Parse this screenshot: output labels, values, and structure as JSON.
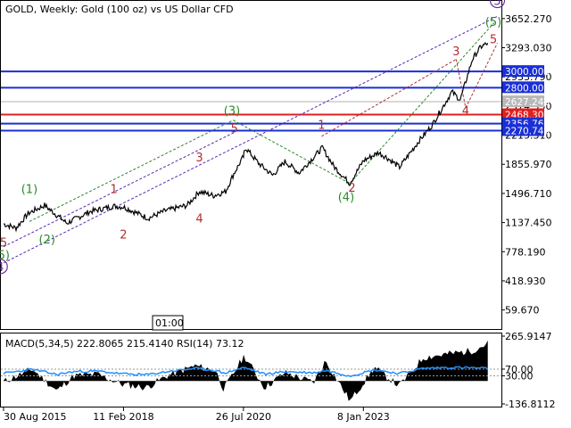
{
  "window": {
    "title": "GOLD, Weekly:  Gold (100 oz) vs US Dollar CFD",
    "time_badge": "01:00"
  },
  "chart_data": [
    {
      "type": "line",
      "title": "GOLD, Weekly:  Gold (100 oz) vs US Dollar CFD",
      "ylim": [
        -175,
        3870
      ],
      "price_ticks": [
        "3652.270",
        "3293.030",
        "2933.790",
        "2574.550",
        "2215.310",
        "1855.970",
        "1496.710",
        "1137.450",
        "778.190",
        "418.930",
        "59.670"
      ],
      "x_ticks": [
        "30 Aug 2015",
        "11 Feb 2018",
        "26 Jul 2020",
        "8 Jan 2023"
      ],
      "x_tick_dates": [
        "2015-08-30",
        "2018-02-11",
        "2020-07-26",
        "2023-01-08"
      ],
      "x_range": [
        "2015-08-30",
        "2025-10-15"
      ],
      "grid": false,
      "price_series": {
        "name": "GOLD",
        "x": [
          "2015-08-30",
          "2015-12-01",
          "2016-03-01",
          "2016-07-01",
          "2016-12-15",
          "2017-06-01",
          "2017-12-01",
          "2018-02-11",
          "2018-08-15",
          "2018-12-15",
          "2019-06-01",
          "2019-09-01",
          "2019-12-15",
          "2020-03-15",
          "2020-05-15",
          "2020-07-26",
          "2020-08-10",
          "2020-11-15",
          "2021-03-01",
          "2021-06-01",
          "2021-09-15",
          "2022-03-08",
          "2022-06-01",
          "2022-09-28",
          "2023-01-08",
          "2023-05-01",
          "2023-07-01",
          "2023-10-05",
          "2024-03-01",
          "2024-06-01",
          "2024-10-30",
          "2025-01-01",
          "2025-04-01",
          "2025-06-01",
          "2025-07-25"
        ],
        "y": [
          1120,
          1070,
          1250,
          1350,
          1130,
          1270,
          1340,
          1330,
          1190,
          1280,
          1350,
          1520,
          1470,
          1520,
          1740,
          1950,
          2060,
          1870,
          1720,
          1890,
          1750,
          2060,
          1830,
          1620,
          1900,
          2000,
          1940,
          1820,
          2150,
          2330,
          2750,
          2650,
          3150,
          3300,
          3350
        ]
      },
      "levels": [
        {
          "label": "3000.000",
          "value": 3000,
          "color": "#1a2fd6"
        },
        {
          "label": "2800.000",
          "value": 2800,
          "color": "#1a2fd6"
        },
        {
          "label": "2627.240",
          "value": 2627.24,
          "color": "#b0b0b0"
        },
        {
          "label": "2468.300",
          "value": 2468.3,
          "color": "#e02020"
        },
        {
          "label": "2356.769",
          "value": 2356.769,
          "color": "#1a2fd6"
        },
        {
          "label": "2270.743",
          "value": 2270.743,
          "color": "#1a2fd6"
        }
      ],
      "wave_labels": [
        {
          "text": "5",
          "date": "2025-10-05",
          "value": 3820,
          "color": "#6a2aa0",
          "circled": true
        },
        {
          "text": "(5)",
          "date": "2025-09-05",
          "value": 3560,
          "color": "#2a8a2a"
        },
        {
          "text": "5",
          "date": "2025-09-05",
          "value": 3350,
          "color": "#b03030"
        },
        {
          "text": "3",
          "date": "2024-12-01",
          "value": 3200,
          "color": "#b03030"
        },
        {
          "text": "4",
          "date": "2025-02-10",
          "value": 2470,
          "color": "#b03030"
        },
        {
          "text": "(3)",
          "date": "2020-05-01",
          "value": 2470,
          "color": "#2a8a2a"
        },
        {
          "text": "5",
          "date": "2020-05-20",
          "value": 2250,
          "color": "#b03030"
        },
        {
          "text": "1",
          "date": "2022-03-01",
          "value": 2290,
          "color": "#b03030"
        },
        {
          "text": "3",
          "date": "2019-09-01",
          "value": 1890,
          "color": "#b03030"
        },
        {
          "text": "(4)",
          "date": "2022-09-01",
          "value": 1400,
          "color": "#2a8a2a"
        },
        {
          "text": "2",
          "date": "2022-10-15",
          "value": 1520,
          "color": "#b03030"
        },
        {
          "text": "(1)",
          "date": "2016-03-10",
          "value": 1500,
          "color": "#2a8a2a"
        },
        {
          "text": "1",
          "date": "2017-12-01",
          "value": 1500,
          "color": "#b03030"
        },
        {
          "text": "4",
          "date": "2019-09-01",
          "value": 1140,
          "color": "#b03030"
        },
        {
          "text": "2",
          "date": "2018-02-11",
          "value": 940,
          "color": "#b03030"
        },
        {
          "text": "(2)",
          "date": "2016-07-20",
          "value": 880,
          "color": "#2a8a2a"
        },
        {
          "text": "5",
          "date": "2015-08-30",
          "value": 840,
          "color": "#b03030"
        },
        {
          "text": "(5)",
          "date": "2015-08-15",
          "value": 690,
          "color": "#2a8a2a"
        },
        {
          "text": "4",
          "date": "2015-08-05",
          "value": 540,
          "color": "#6a2aa0",
          "circled": true
        }
      ]
    },
    {
      "type": "area",
      "title": "MACD(5,34,5) 222.8065 215.4140 RSI(14) 73.12",
      "y_ticks": [
        "265.9147",
        "70.00",
        "30.00",
        "-136.8112"
      ],
      "ylim": [
        -136.8112,
        265.9147
      ],
      "macd_series": {
        "name": "MACD(5,34,5)",
        "x": [
          "2015-08-30",
          "2016-04-01",
          "2016-10-01",
          "2017-02-01",
          "2017-08-01",
          "2018-02-01",
          "2018-08-01",
          "2019-01-01",
          "2019-08-01",
          "2020-01-01",
          "2020-03-01",
          "2020-08-01",
          "2021-01-01",
          "2021-06-01",
          "2022-01-01",
          "2022-04-01",
          "2022-10-01",
          "2023-04-01",
          "2023-10-01",
          "2024-04-01",
          "2024-10-01",
          "2025-04-01",
          "2025-07-25"
        ],
        "values": [
          -5,
          70,
          -60,
          30,
          40,
          -20,
          -40,
          30,
          90,
          60,
          -50,
          150,
          -40,
          50,
          -10,
          120,
          -120,
          80,
          -30,
          140,
          160,
          180,
          222.8
        ]
      },
      "rsi_series": {
        "name": "RSI(14)",
        "x": [
          "2015-08-30",
          "2016-04-01",
          "2016-10-01",
          "2017-02-01",
          "2017-08-01",
          "2018-02-01",
          "2018-08-01",
          "2019-01-01",
          "2019-08-01",
          "2020-01-01",
          "2020-03-01",
          "2020-08-01",
          "2021-01-01",
          "2021-06-01",
          "2022-01-01",
          "2022-04-01",
          "2022-10-01",
          "2023-04-01",
          "2023-10-01",
          "2024-04-01",
          "2024-10-01",
          "2025-04-01",
          "2025-07-25"
        ],
        "values": [
          45,
          68,
          38,
          55,
          58,
          42,
          36,
          55,
          75,
          62,
          45,
          80,
          40,
          55,
          48,
          62,
          30,
          66,
          44,
          75,
          80,
          78,
          73.12
        ]
      }
    }
  ]
}
